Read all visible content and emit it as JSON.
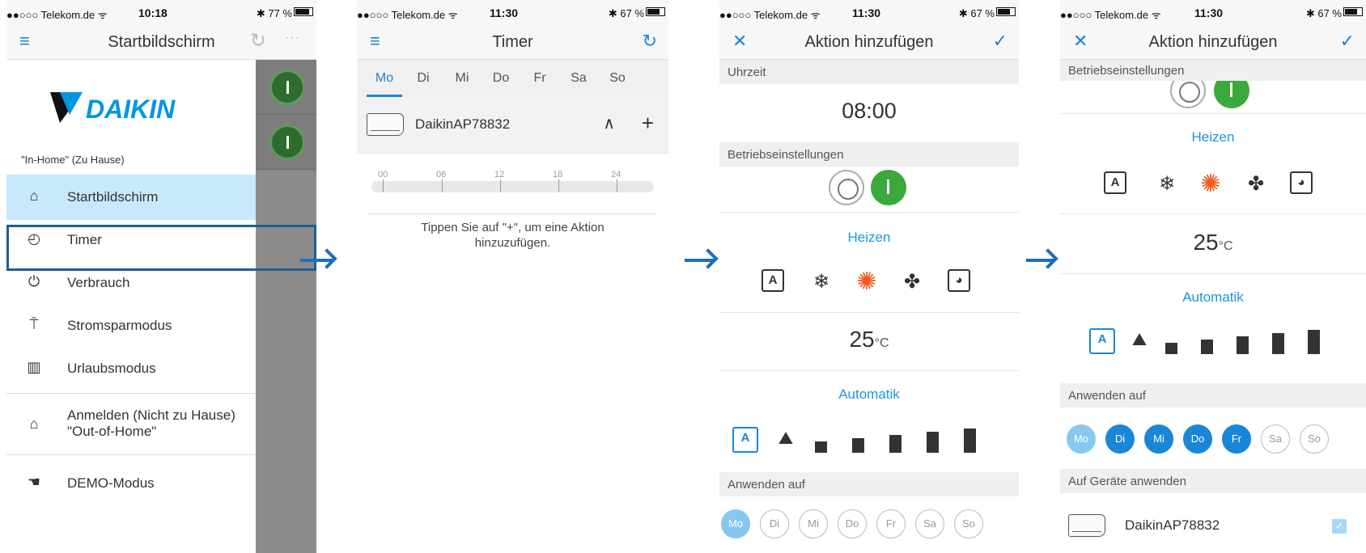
{
  "phones": [
    {
      "status": {
        "carrier": "●●○○○ Telekom.de ᯤ",
        "time": "10:18",
        "battery": "✱ 77 %"
      },
      "title": "Startbildschirm",
      "brand": "DAIKIN",
      "home_label": "\"In-Home\" (Zu Hause)",
      "menu": [
        {
          "label": "Startbildschirm",
          "icon": "home-icon"
        },
        {
          "label": "Timer",
          "icon": "clock-icon"
        },
        {
          "label": "Verbrauch",
          "icon": "plug-icon"
        },
        {
          "label": "Stromsparmodus",
          "icon": "eco-icon"
        },
        {
          "label": "Urlaubsmodus",
          "icon": "suitcase-icon"
        },
        {
          "label": "Anmelden (Nicht zu Hause)\n\"Out-of-Home\"",
          "icon": "away-home-icon"
        },
        {
          "label": "DEMO-Modus",
          "icon": "demo-icon"
        }
      ]
    },
    {
      "status": {
        "carrier": "●●○○○ Telekom.de ᯤ",
        "time": "11:30",
        "battery": "✱ 67 %"
      },
      "title": "Timer",
      "days": [
        "Mo",
        "Di",
        "Mi",
        "Do",
        "Fr",
        "Sa",
        "So"
      ],
      "selected_day": "Mo",
      "device": "DaikinAP78832",
      "ticks": [
        "00",
        "06",
        "12",
        "18",
        "24"
      ],
      "hint": "Tippen Sie auf \"+\", um eine Aktion hinzuzufügen."
    },
    {
      "status": {
        "carrier": "●●○○○ Telekom.de ᯤ",
        "time": "11:30",
        "battery": "✱ 67 %"
      },
      "title": "Aktion hinzufügen",
      "time_label": "Uhrzeit",
      "time_value": "08:00",
      "settings_label": "Betriebseinstellungen",
      "mode": "Heizen",
      "temp": "25",
      "temp_unit": "°C",
      "fan": "Automatik",
      "apply_label": "Anwenden auf",
      "days": [
        "Mo",
        "Di",
        "Mi",
        "Do",
        "Fr",
        "Sa",
        "So"
      ]
    },
    {
      "status": {
        "carrier": "●●○○○ Telekom.de ᯤ",
        "time": "11:30",
        "battery": "✱ 67 %"
      },
      "title": "Aktion hinzufügen",
      "settings_label": "Betriebseinstellungen",
      "mode": "Heizen",
      "temp": "25",
      "temp_unit": "°C",
      "fan": "Automatik",
      "apply_label": "Anwenden auf",
      "days": [
        "Mo",
        "Di",
        "Mi",
        "Do",
        "Fr",
        "Sa",
        "So"
      ],
      "devices_label": "Auf Geräte anwenden",
      "device": "DaikinAP78832"
    }
  ],
  "colors": {
    "accent": "#1a86d8",
    "active_row": "#c8e8fb",
    "power_on": "#3aa83a",
    "heat": "#f25a1e",
    "daikin_blue": "#0097e0"
  }
}
